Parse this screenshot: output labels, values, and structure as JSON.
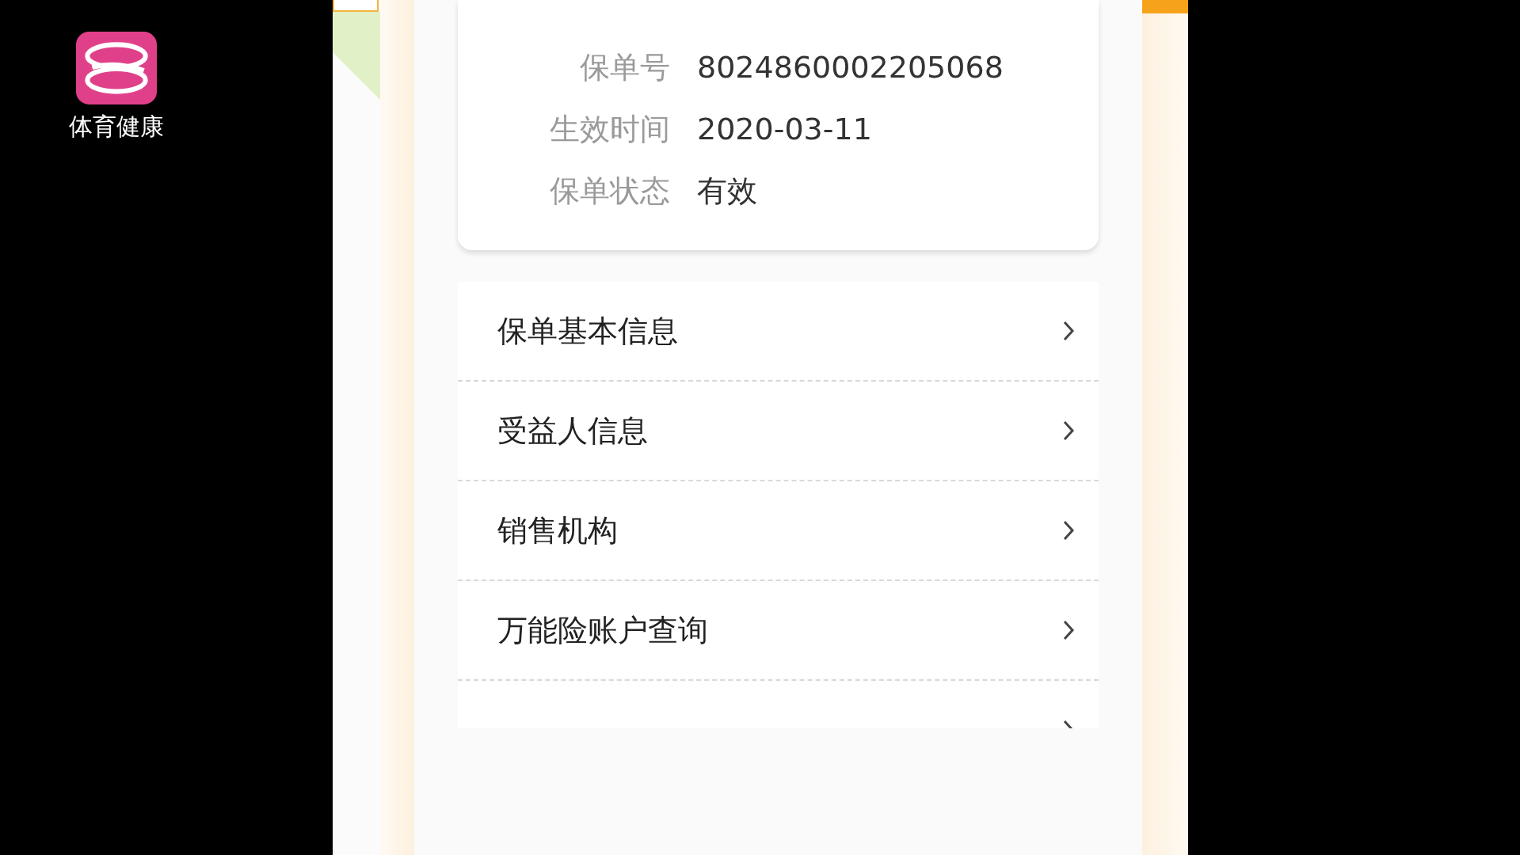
{
  "channel_logo": {
    "text": "体育健康"
  },
  "policy_card": {
    "fields": [
      {
        "label": "保单号",
        "value": "8024860002205068"
      },
      {
        "label": "生效时间",
        "value": "2020-03-11"
      },
      {
        "label": "保单状态",
        "value": "有效"
      }
    ]
  },
  "menu": [
    {
      "kind": "item",
      "label": "保单基本信息"
    },
    {
      "kind": "item",
      "label": "受益人信息"
    },
    {
      "kind": "item",
      "label": "销售机构"
    },
    {
      "kind": "item",
      "label": "万能险账户查询"
    },
    {
      "kind": "cut"
    }
  ]
}
